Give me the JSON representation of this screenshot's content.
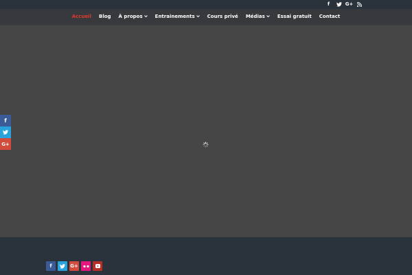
{
  "top_bar": {
    "social_icons": [
      {
        "name": "facebook-icon",
        "glyph": "f"
      },
      {
        "name": "twitter-icon",
        "glyph": "🐦"
      },
      {
        "name": "google-plus-icon",
        "glyph": "G+"
      },
      {
        "name": "rss-icon",
        "glyph": "◉"
      }
    ]
  },
  "nav": {
    "items": [
      {
        "label": "Accueil",
        "active": true,
        "dropdown": false
      },
      {
        "label": "Blog",
        "active": false,
        "dropdown": false
      },
      {
        "label": "À propos",
        "active": false,
        "dropdown": true
      },
      {
        "label": "Entrainements",
        "active": false,
        "dropdown": true
      },
      {
        "label": "Cours privé",
        "active": false,
        "dropdown": false
      },
      {
        "label": "Médias",
        "active": false,
        "dropdown": true
      },
      {
        "label": "Essai gratuit",
        "active": false,
        "dropdown": false
      },
      {
        "label": "Contact",
        "active": false,
        "dropdown": false
      }
    ],
    "chevron": "⌄",
    "accent_color": "#e03a2d"
  },
  "share_bar": {
    "buttons": [
      {
        "name": "facebook-share-icon",
        "glyph": "f"
      },
      {
        "name": "twitter-share-icon",
        "glyph": "🐦"
      },
      {
        "name": "google-plus-share-icon",
        "glyph": "G+"
      }
    ]
  },
  "footer": {
    "social_icons": [
      {
        "name": "facebook-icon",
        "glyph": "f"
      },
      {
        "name": "twitter-icon",
        "glyph": "🐦"
      },
      {
        "name": "google-plus-icon",
        "glyph": "G+"
      },
      {
        "name": "flickr-icon",
        "glyph": "••"
      },
      {
        "name": "youtube-icon",
        "glyph": "▶"
      }
    ]
  },
  "colors": {
    "topbar_bg": "#2a323b",
    "nav_bg": "#37393d",
    "main_bg": "#464646",
    "footer_bg": "#2a323b"
  }
}
